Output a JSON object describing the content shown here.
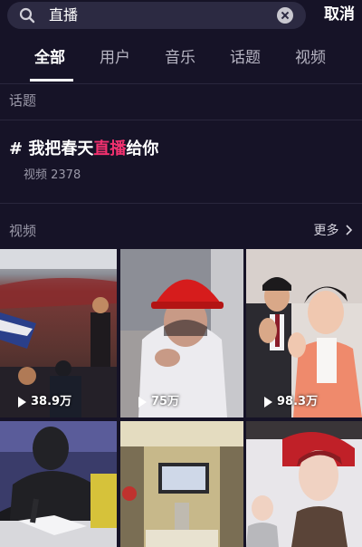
{
  "search": {
    "query": "直播",
    "cancel_label": "取消"
  },
  "tabs": [
    {
      "label": "全部",
      "active": true
    },
    {
      "label": "用户",
      "active": false
    },
    {
      "label": "音乐",
      "active": false
    },
    {
      "label": "话题",
      "active": false
    },
    {
      "label": "视频",
      "active": false
    }
  ],
  "topics_section": {
    "label": "话题",
    "topic": {
      "prefix": "# 我把春天",
      "highlight": "直播",
      "suffix": "给你",
      "count_text": "视频 2378"
    }
  },
  "videos_section": {
    "label": "视频",
    "more_label": "更多",
    "items": [
      {
        "play_count": "38.9万"
      },
      {
        "play_count": "75万"
      },
      {
        "play_count": "98.3万"
      },
      {
        "play_count": ""
      },
      {
        "play_count": ""
      },
      {
        "play_count": ""
      }
    ]
  },
  "colors": {
    "background": "#161327",
    "highlight": "#f1316f"
  }
}
